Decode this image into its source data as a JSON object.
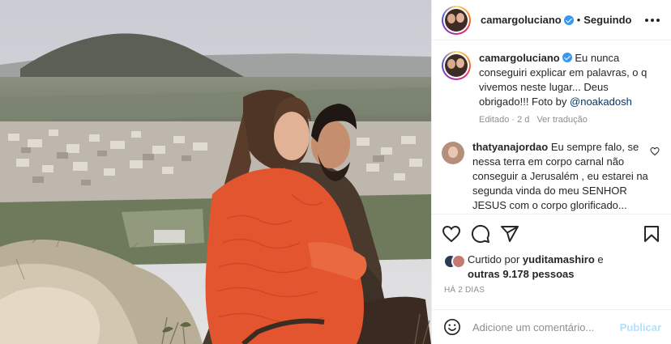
{
  "header": {
    "username": "camargoluciano",
    "separator": "•",
    "follow_status": "Seguindo"
  },
  "caption": {
    "username": "camargoluciano",
    "text": "Eu nunca conseguiri explicar em palavras, o q vivemos neste lugar... Deus obrigado!!! Foto by ",
    "mention": "@noakadosh",
    "edited": "Editado · 2 d",
    "see_translation": "Ver tradução"
  },
  "comments": [
    {
      "username": "thatyanajordao",
      "text": "Eu sempre falo, se nessa terra em corpo carnal não conseguir a Jerusalém , eu estarei na segunda vinda do meu SENHOR JESUS com o corpo glorificado... amem"
    }
  ],
  "likes": {
    "prefix": "Curtido por ",
    "liker": "yuditamashiro",
    "suffix": " e",
    "others": "outras 9.178 pessoas"
  },
  "time_ago": "HÁ 2 DIAS",
  "add_comment": {
    "placeholder": "Adicione um comentário...",
    "publish": "Publicar"
  },
  "icons": {
    "header_avatar": "avatar",
    "verified": "verified-badge-icon",
    "more": "more-options-icon",
    "like": "heart-icon",
    "comment": "comment-icon",
    "share": "share-icon",
    "save": "bookmark-icon",
    "emoji": "emoji-icon"
  },
  "colors": {
    "verified": "#3897f0",
    "mention": "#00376b",
    "muted": "#8e8e8e",
    "publish_disabled": "#b2dffc"
  }
}
